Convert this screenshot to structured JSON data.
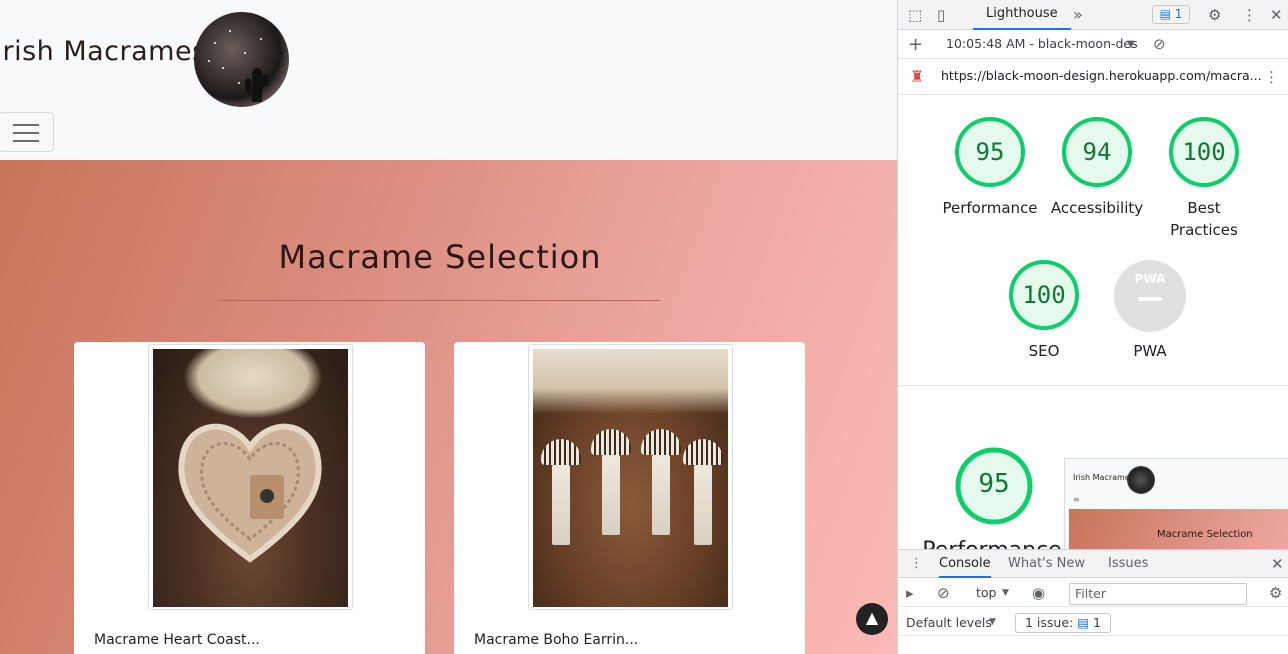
{
  "site": {
    "brand": "Irish Macrames",
    "section_title": "Macrame Selection",
    "cards": [
      {
        "caption": "Macrame Heart Coast..."
      },
      {
        "caption": "Macrame Boho Earrin..."
      }
    ],
    "scroll_top_icon": "chevron-up-icon"
  },
  "devtools": {
    "active_tab": "Lighthouse",
    "more_tabs": "»",
    "issues_badge": "1",
    "report_time": "10:05:48 AM - black-moon-des",
    "url": "https://black-moon-design.herokuapp.com/macra...",
    "scores": [
      {
        "label": "Performance",
        "value": 95
      },
      {
        "label": "Accessibility",
        "value": 94
      },
      {
        "label": "Best Practices",
        "value": 100
      },
      {
        "label": "SEO",
        "value": 100
      }
    ],
    "pwa": {
      "label": "PWA",
      "icon_text": "PWA"
    },
    "big_score": {
      "value": 95,
      "label": "Performance"
    },
    "thumbnail": {
      "brand": "Irish Macrames",
      "title": "Macrame Selection"
    },
    "console": {
      "tabs": [
        "Console",
        "What's New",
        "Issues"
      ],
      "context": "top",
      "filter_placeholder": "Filter",
      "levels": "Default levels",
      "issues": "1 issue:",
      "issues_count": "1"
    },
    "colors": {
      "pass": "#0cce6b",
      "pass_text": "#0a7a36",
      "accent": "#1a73e8"
    }
  }
}
